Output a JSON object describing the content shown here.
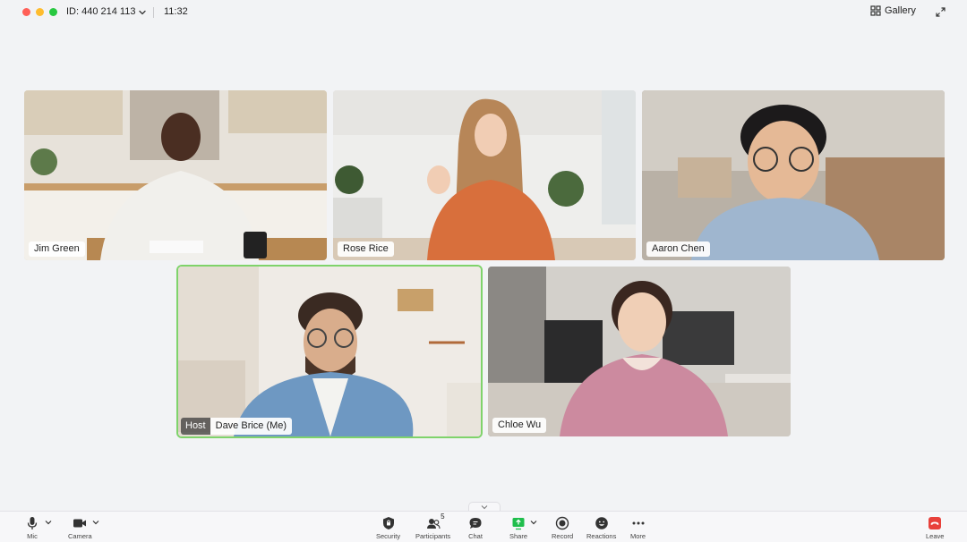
{
  "window": {
    "meeting_id": "ID: 440 214 113",
    "timer": "11:32",
    "view_label": "Gallery"
  },
  "participants": [
    {
      "name": "Jim Green"
    },
    {
      "name": "Rose Rice"
    },
    {
      "name": "Aaron Chen"
    },
    {
      "name": "Dave Brice (Me)",
      "role": "Host",
      "speaking": true
    },
    {
      "name": "Chloe Wu"
    }
  ],
  "toolbar": {
    "mic": "Mic",
    "camera": "Camera",
    "security": "Security",
    "participants": "Participants",
    "participants_count": "5",
    "chat": "Chat",
    "share": "Share",
    "record": "Record",
    "reactions": "Reactions",
    "more": "More",
    "leave": "Leave"
  },
  "colors": {
    "active_speaker_border": "#7fd36b",
    "share_green": "#1fbe4c",
    "leave_red": "#e8413b"
  }
}
